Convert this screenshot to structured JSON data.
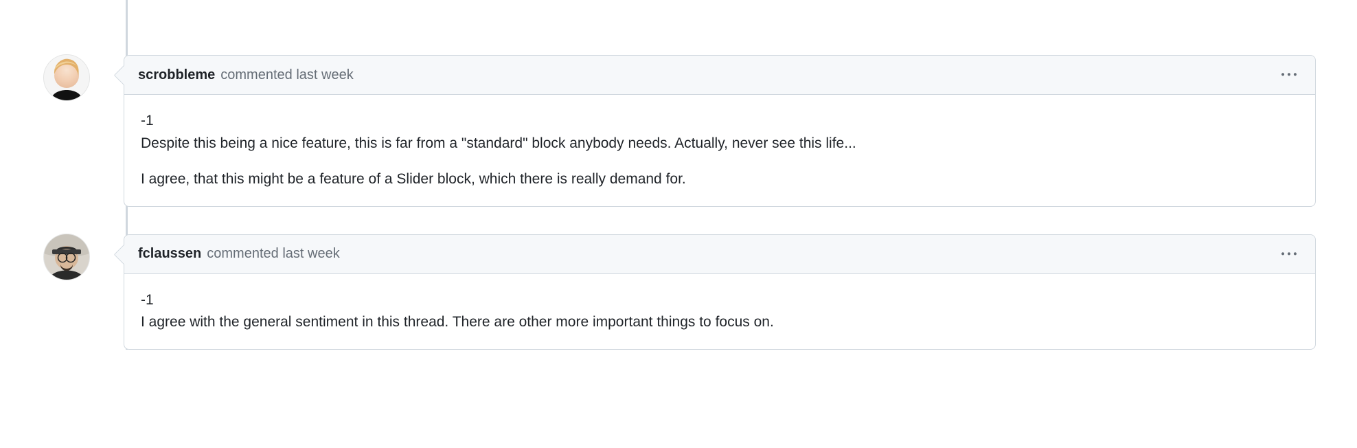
{
  "comments": [
    {
      "author": "scrobbleme",
      "verb": "commented",
      "timestamp": "last week",
      "body_line1": "-1",
      "body_line2": "Despite this being a nice feature, this is far from a \"standard\" block anybody needs. Actually, never see this life...",
      "body_line3": "I agree, that this might be a feature of a Slider block, which there is really demand for."
    },
    {
      "author": "fclaussen",
      "verb": "commented",
      "timestamp": "last week",
      "body_line1": "-1",
      "body_line2": "I agree with the general sentiment in this thread. There are other more important things to focus on."
    }
  ]
}
